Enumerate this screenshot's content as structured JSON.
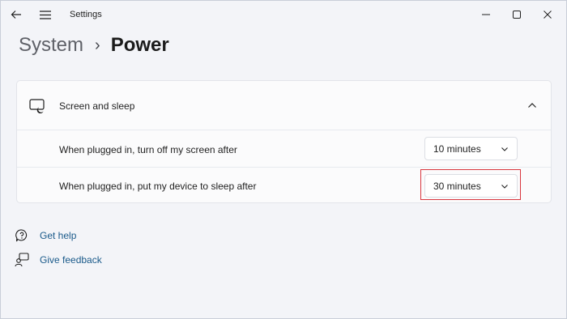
{
  "titlebar": {
    "app_title": "Settings",
    "back_icon": "back-arrow-icon",
    "menu_icon": "hamburger-menu-icon",
    "minimize_icon": "minimize-icon",
    "maximize_icon": "maximize-icon",
    "close_icon": "close-icon"
  },
  "breadcrumb": {
    "parent": "System",
    "separator": "›",
    "current": "Power"
  },
  "screen_and_sleep": {
    "title": "Screen and sleep",
    "icon": "screen-sleep-icon",
    "expanded": true,
    "rows": [
      {
        "label": "When plugged in, turn off my screen after",
        "value": "10 minutes"
      },
      {
        "label": "When plugged in, put my device to sleep after",
        "value": "30 minutes",
        "highlighted": true
      }
    ]
  },
  "links": {
    "get_help": "Get help",
    "give_feedback": "Give feedback"
  },
  "colors": {
    "background": "#f3f4f8",
    "card": "#fbfbfc",
    "link": "#1a5a8a",
    "highlight": "#d9363e"
  }
}
